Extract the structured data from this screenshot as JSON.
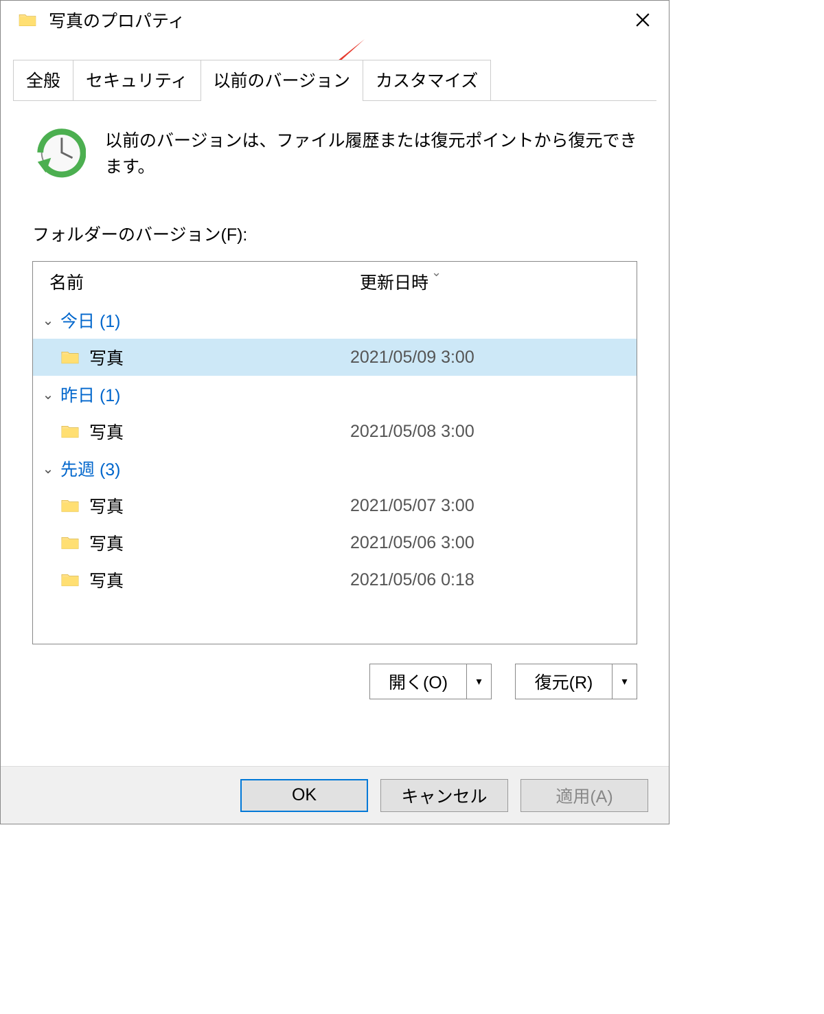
{
  "window": {
    "title": "写真のプロパティ"
  },
  "tabs": {
    "general": "全般",
    "security": "セキュリティ",
    "previousVersions": "以前のバージョン",
    "customize": "カスタマイズ"
  },
  "description": "以前のバージョンは、ファイル履歴または復元ポイントから復元できます。",
  "listLabel": "フォルダーのバージョン(F):",
  "columns": {
    "name": "名前",
    "modified": "更新日時"
  },
  "groups": {
    "today": "今日 (1)",
    "yesterday": "昨日 (1)",
    "lastWeek": "先週 (3)"
  },
  "items": {
    "today0": {
      "name": "写真",
      "date": "2021/05/09 3:00"
    },
    "yesterday0": {
      "name": "写真",
      "date": "2021/05/08 3:00"
    },
    "lastWeek0": {
      "name": "写真",
      "date": "2021/05/07 3:00"
    },
    "lastWeek1": {
      "name": "写真",
      "date": "2021/05/06 3:00"
    },
    "lastWeek2": {
      "name": "写真",
      "date": "2021/05/06 0:18"
    }
  },
  "actions": {
    "open": "開く(O)",
    "restore": "復元(R)"
  },
  "footer": {
    "ok": "OK",
    "cancel": "キャンセル",
    "apply": "適用(A)"
  }
}
